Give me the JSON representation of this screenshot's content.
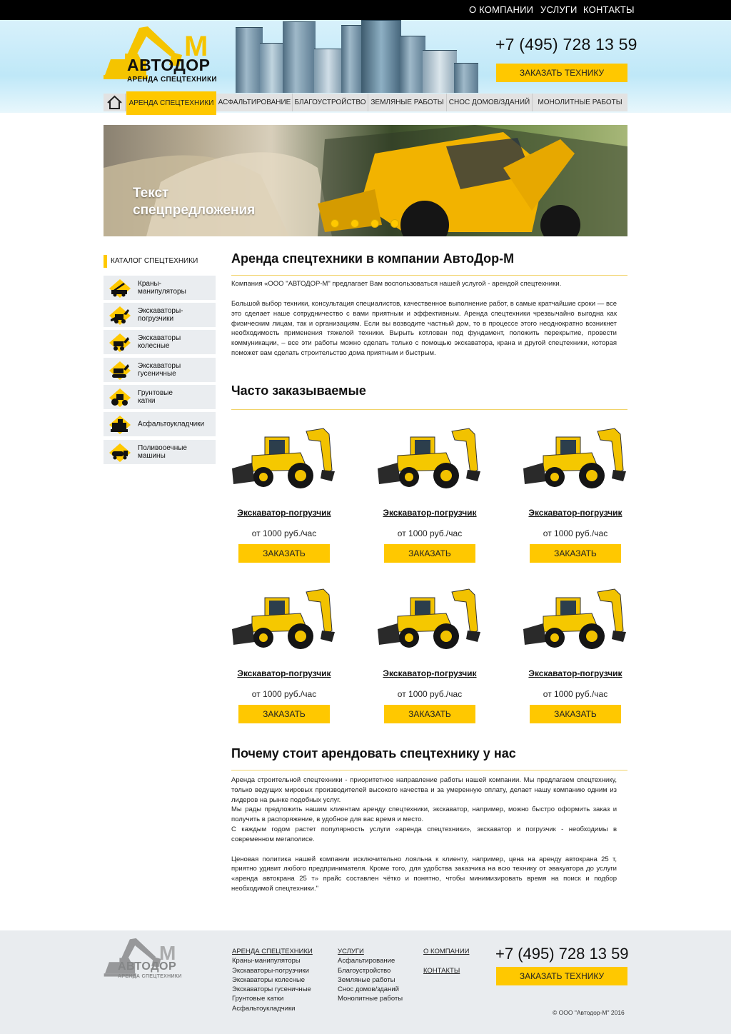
{
  "topnav": [
    "О КОМПАНИИ",
    "УСЛУГИ",
    "КОНТАКТЫ"
  ],
  "logo": {
    "word": "АВТОДОР",
    "letter": "М",
    "sub": "АРЕНДА СПЕЦТЕХНИКИ"
  },
  "header": {
    "phone": "+7 (495) 728 13 59",
    "order_button": "ЗАКАЗАТЬ ТЕХНИКУ"
  },
  "menu": [
    "АРЕНДА СПЕЦТЕХНИКИ",
    "АСФАЛЬТИРОВАНИЕ",
    "БЛАГОУСТРОЙСТВО",
    "ЗЕМЛЯНЫЕ РАБОТЫ",
    "СНОС ДОМОВ/ЗДАНИЙ",
    "МОНОЛИТНЫЕ РАБОТЫ"
  ],
  "hero": {
    "line1": "Текст",
    "line2": "спецпредложения",
    "slides": 4,
    "active_slide": 1
  },
  "catalog": {
    "title": "КАТАЛОГ СПЕЦТЕХНИКИ",
    "items": [
      {
        "l1": "Краны-",
        "l2": "манипуляторы",
        "icon": "crane-truck-icon"
      },
      {
        "l1": "Экскаваторы-",
        "l2": "погрузчики",
        "icon": "backhoe-loader-icon"
      },
      {
        "l1": "Экскаваторы",
        "l2": "колесные",
        "icon": "wheeled-excavator-icon"
      },
      {
        "l1": "Экскаваторы",
        "l2": "гусеничные",
        "icon": "tracked-excavator-icon"
      },
      {
        "l1": "Грунтовые",
        "l2": "катки",
        "icon": "road-roller-icon"
      },
      {
        "l1": "Асфальтоукладчики",
        "l2": "",
        "icon": "asphalt-paver-icon"
      },
      {
        "l1": "Поливооечные",
        "l2": "машины",
        "icon": "watering-truck-icon"
      }
    ]
  },
  "main": {
    "title": "Аренда спецтехники в компании АвтоДор-М",
    "intro": "Компания «ООО \"АВТОДОР-М\" предлагает Вам воспользоваться нашей услугой  - арендой спецтехники.",
    "body": "Большой выбор техники, консультация специалистов, качественное выполнение работ, в самые кратчайшие сроки — все это сделает наше сотрудничество с вами приятным и эффективным. Аренда спецтехники чрезвычайно выгодна как физическим лицам, так и организациям.  Если вы возводите частный дом, то в процессе этого неоднократно возникнет необходимость применения тяжелой техники. Вырыть котлован под фундамент, положить перекрытие, провести коммуникации,  – все эти работы можно сделать только  с помощью экскаватора, крана и  другой спецтехники, которая поможет вам сделать строительство  дома приятным и быстрым.",
    "popular_title": "Часто заказываемые",
    "products": [
      {
        "name": "Экскаватор-погрузчик",
        "price": "от 1000 руб./час",
        "button": "ЗАКАЗАТЬ"
      },
      {
        "name": "Экскаватор-погрузчик",
        "price": "от 1000 руб./час",
        "button": "ЗАКАЗАТЬ"
      },
      {
        "name": "Экскаватор-погрузчик",
        "price": "от 1000 руб./час",
        "button": "ЗАКАЗАТЬ"
      },
      {
        "name": "Экскаватор-погрузчик",
        "price": "от 1000 руб./час",
        "button": "ЗАКАЗАТЬ"
      },
      {
        "name": "Экскаватор-погрузчик",
        "price": "от 1000 руб./час",
        "button": "ЗАКАЗАТЬ"
      },
      {
        "name": "Экскаватор-погрузчик",
        "price": "от 1000 руб./час",
        "button": "ЗАКАЗАТЬ"
      }
    ],
    "why_title": "Почему стоит арендовать спецтехнику у нас",
    "why_p1": "Аренда строительной спецтехники - приоритетное направление работы нашей компании. Мы предлагаем спецтехнику, только ведущих мировых производителей высокого качества и за умеренную оплату, делает нашу компанию одним из лидеров на рынке подобных услуг.",
    "why_p2": "Мы рады предложить нашим клиентам  аренду спецтехники, экскаватор, например, можно быстро оформить заказ и получить в распоряжение, в удобное для вас время и место.",
    "why_p3": "С каждым годом растет популярность услуги «аренда спецтехники», экскаватор и погрузчик - необходимы в современном мегаполисе.",
    "why_p4": "Ценовая политика нашей компании исключительно лояльна к клиенту, например, цена на аренду автокрана 25 т, приятно удивит любого предпринимателя. Кроме того, для удобства заказчика на всю технику от эвакуатора до услуги «аренда автокрана 25 т» прайс составлен чётко и понятно, чтобы минимизировать время на поиск и подбор необходимой спецтехники.\""
  },
  "footer": {
    "col1_title": "АРЕНДА СПЕЦТЕХНИКИ",
    "col1": [
      "Краны-манипуляторы",
      "Экскаваторы-погрузчики",
      "Экскаваторы колесные",
      "Экскаваторы гусеничные",
      "Грунтовые катки",
      "Асфальтоукладчики"
    ],
    "col2_title": "УСЛУГИ",
    "col2": [
      "Асфальтирование",
      "Благоустройство",
      "Земляные работы",
      "Снос домов/зданий",
      "Монолитные работы"
    ],
    "col3": [
      "О КОМПАНИИ",
      "КОНТАКТЫ"
    ],
    "phone": "+7 (495) 728 13 59",
    "order_button": "ЗАКАЗАТЬ ТЕХНИКУ",
    "copyright": "© ООО \"Автодор-М\" 2016"
  },
  "colors": {
    "accent": "#ffc800",
    "topbar": "#000000",
    "footer_bg": "#e9ecef",
    "menu_bg": "#e2e2e2"
  }
}
